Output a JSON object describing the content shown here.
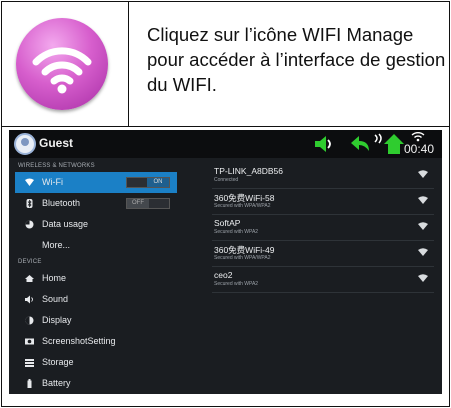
{
  "instruction": {
    "text": "Cliquez sur l’icône WIFI Manage pour accéder à l’interface de gestion du WIFI.",
    "icon": "wifi-manage-app-icon",
    "icon_color": "#c44cbf"
  },
  "screenshot": {
    "status_bar": {
      "user_name": "Guest",
      "clock": "00:40",
      "icons": [
        "volume-icon",
        "back-icon",
        "home-icon",
        "wifi-signal-icon"
      ],
      "accent_color": "#2fcc2f"
    },
    "settings": {
      "sections": [
        {
          "title": "WIRELESS & NETWORKS",
          "items": [
            {
              "label": "Wi-Fi",
              "icon": "wifi-icon",
              "selected": true,
              "toggle": "ON"
            },
            {
              "label": "Bluetooth",
              "icon": "bluetooth-icon",
              "toggle": "OFF"
            },
            {
              "label": "Data usage",
              "icon": "data-usage-icon"
            },
            {
              "label": "More...",
              "icon": ""
            }
          ]
        },
        {
          "title": "DEVICE",
          "items": [
            {
              "label": "Home",
              "icon": "home-icon"
            },
            {
              "label": "Sound",
              "icon": "sound-icon"
            },
            {
              "label": "Display",
              "icon": "display-icon"
            },
            {
              "label": "ScreenshotSetting",
              "icon": "screenshot-icon"
            },
            {
              "label": "Storage",
              "icon": "storage-icon"
            },
            {
              "label": "Battery",
              "icon": "battery-icon"
            }
          ]
        }
      ]
    },
    "networks": [
      {
        "name": "TP-LINK_A8DB56",
        "status": "Connected"
      },
      {
        "name": "360免费WiFi-58",
        "status": "Secured with WPA/WPA2"
      },
      {
        "name": "SoftAP",
        "status": "Secured with WPA2"
      },
      {
        "name": "360免费WiFi-49",
        "status": "Secured with WPA/WPA2"
      },
      {
        "name": "ceo2",
        "status": "Secured with WPA2"
      }
    ],
    "selected_color": "#1b80c6"
  }
}
